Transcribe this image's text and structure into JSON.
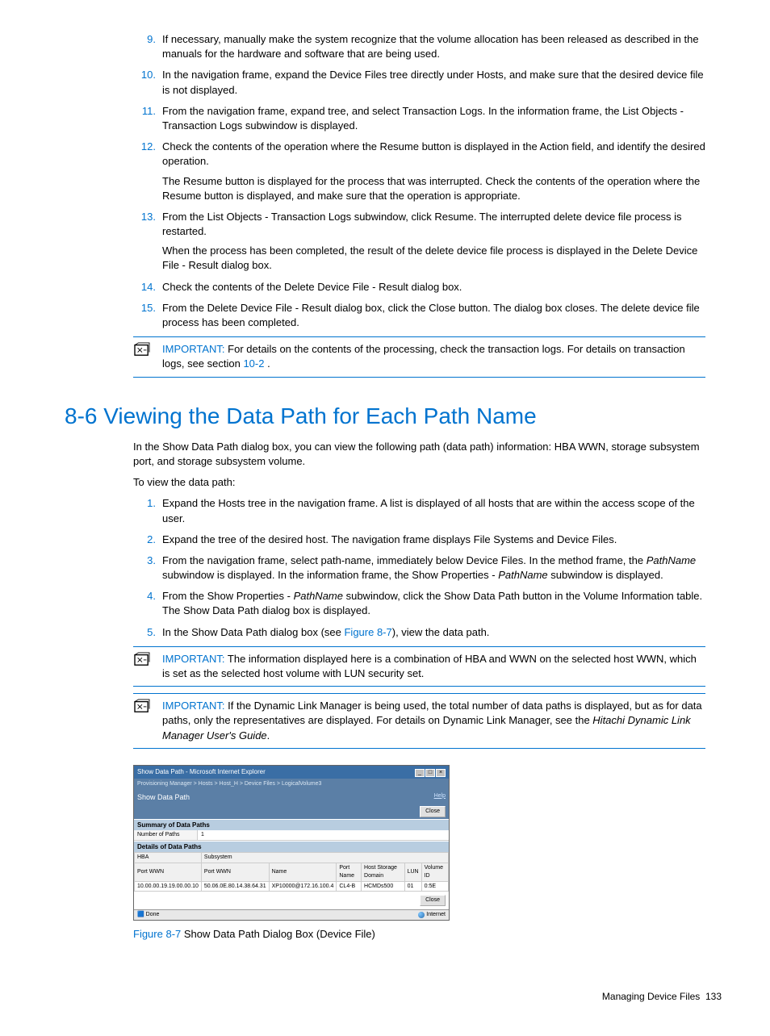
{
  "upper_steps": [
    {
      "num": "9.",
      "text": "If necessary, manually make the system recognize that the volume allocation has been released as described in the manuals for the hardware and software that are being used."
    },
    {
      "num": "10.",
      "text": "In the navigation frame, expand the Device Files tree directly under Hosts, and make sure that the desired device file is not displayed."
    },
    {
      "num": "11.",
      "text": "From the navigation frame, expand tree, and select Transaction Logs. In the information frame, the List Objects - Transaction Logs subwindow is displayed."
    },
    {
      "num": "12.",
      "text": "Check the contents of the operation where the Resume button is displayed in the Action field, and identify the desired operation.",
      "extra": "The Resume button is displayed for the process that was interrupted. Check the contents of the operation where the Resume button is displayed, and make sure that the operation is appropriate."
    },
    {
      "num": "13.",
      "text": "From the List Objects - Transaction Logs subwindow, click Resume. The interrupted delete device file process is restarted.",
      "extra": "When the process has been completed, the result of the delete device file process is displayed in the Delete Device File - Result dialog box."
    },
    {
      "num": "14.",
      "text": "Check the contents of the Delete Device File - Result dialog box."
    },
    {
      "num": "15.",
      "text": "From the Delete Device File - Result dialog box, click the Close button. The dialog box closes. The delete device file process has been completed."
    }
  ],
  "important1": {
    "label": "IMPORTANT:",
    "text_before": "  For details on the contents of the processing, check the transaction logs. For details on transaction logs, see section ",
    "link": "10-2",
    "text_after": " ."
  },
  "heading": "8-6 Viewing the Data Path for Each Path Name",
  "intro_para": "In the Show Data Path dialog box, you can view the following path (data path) information: HBA WWN, storage subsystem port, and storage subsystem volume.",
  "to_view": "To view the data path:",
  "lower_steps": [
    {
      "num": "1.",
      "text": "Expand the Hosts tree in the navigation frame. A list is displayed of all hosts that are within the access scope of the user."
    },
    {
      "num": "2.",
      "text": "Expand the tree of the desired host. The navigation frame displays File Systems and Device Files."
    },
    {
      "num": "3.",
      "text_pre": "From the navigation frame, select path-name, immediately below Device Files. In the method frame, the ",
      "italic1": "PathName",
      "text_mid": " subwindow is displayed. In the information frame, the Show Properties - ",
      "italic2": "PathName",
      "text_post": " subwindow is displayed."
    },
    {
      "num": "4.",
      "text_pre": "From the Show Properties - ",
      "italic1": "PathName",
      "text_post": " subwindow, click the Show Data Path button in the Volume Information table. The Show Data Path dialog box is displayed."
    },
    {
      "num": "5.",
      "text_pre": "In the Show Data Path dialog box (see ",
      "link": "Figure 8-7",
      "text_post": "), view the data path."
    }
  ],
  "important2": {
    "label": "IMPORTANT:",
    "text": "  The information displayed here is a combination of HBA and WWN on the selected host WWN, which is set as the selected host volume with LUN security set."
  },
  "important3": {
    "label": "IMPORTANT:",
    "text_pre": "  If the Dynamic Link Manager is being used, the total number of data paths is displayed, but as for data paths, only the representatives are displayed. For details on Dynamic Link Manager, see the ",
    "italic": "Hitachi Dynamic Link Manager User's Guide",
    "text_post": "."
  },
  "dialog": {
    "title": "Show Data Path - Microsoft Internet Explorer",
    "breadcrumb": "Provisioning Manager > Hosts > Host_H > Device Files > LogicalVolume3",
    "header": "Show Data Path",
    "help": "Help",
    "close": "Close",
    "summary_label": "Summary of Data Paths",
    "num_paths_label": "Number of Paths",
    "num_paths_value": "1",
    "details_label": "Details of Data Paths",
    "group_hba": "HBA",
    "group_subsystem": "Subsystem",
    "cols": {
      "portwwn1": "Port WWN",
      "portwwn2": "Port WWN",
      "name": "Name",
      "portname": "Port Name",
      "hsd": "Host Storage Domain",
      "lun": "LUN",
      "volid": "Volume ID"
    },
    "row": {
      "portwwn1": "10.00.00.19.19.00.00.10",
      "portwwn2": "50.06.0E.80.14.38.64.31",
      "name": "XP10000@172.16.100.4",
      "portname": "CL4-B",
      "hsd": "HCMDs500",
      "lun": "01",
      "volid": "0:5E"
    },
    "done": "Done",
    "internet": "Internet"
  },
  "figure_caption_num": "Figure 8-7",
  "figure_caption_text": " Show Data Path Dialog Box (Device File)",
  "footer_text": "Managing Device Files",
  "footer_page": "133"
}
